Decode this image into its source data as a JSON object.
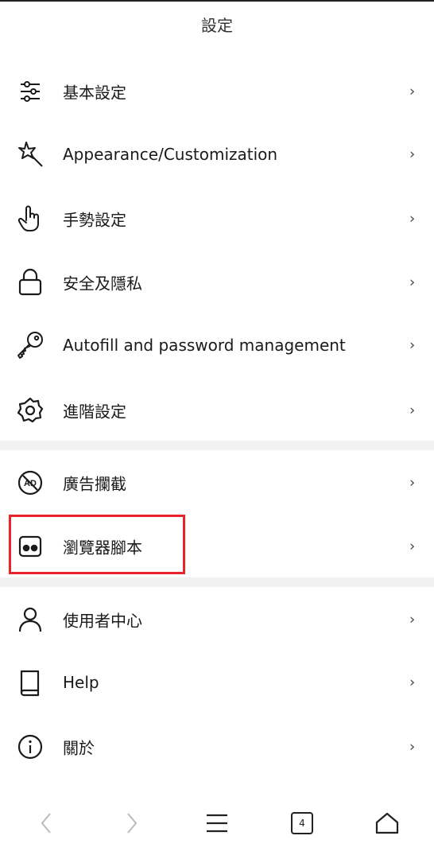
{
  "header": {
    "title": "設定"
  },
  "settings": {
    "items": [
      {
        "label": "基本設定",
        "icon": "sliders-icon",
        "chevron": "›"
      },
      {
        "label": "Appearance/Customization",
        "icon": "magic-wand-icon",
        "chevron": "›"
      },
      {
        "label": "手勢設定",
        "icon": "gesture-hand-icon",
        "chevron": "›"
      },
      {
        "label": "安全及隱私",
        "icon": "lock-icon",
        "chevron": "›"
      },
      {
        "label": "Autofill and password management",
        "icon": "key-icon",
        "chevron": "›"
      },
      {
        "label": "進階設定",
        "icon": "gear-icon",
        "chevron": "›"
      },
      {
        "label": "廣告攔截",
        "icon": "ad-block-icon",
        "chevron": "›"
      },
      {
        "label": "瀏覽器腳本",
        "icon": "script-icon",
        "chevron": "›"
      },
      {
        "label": "使用者中心",
        "icon": "user-icon",
        "chevron": "›"
      },
      {
        "label": "Help",
        "icon": "book-icon",
        "chevron": "›"
      },
      {
        "label": "關於",
        "icon": "info-icon",
        "chevron": "›"
      }
    ]
  },
  "bottom_bar": {
    "tab_count": "4"
  },
  "colors": {
    "highlight": "#e8232a",
    "separator": "#f1f1f1"
  }
}
